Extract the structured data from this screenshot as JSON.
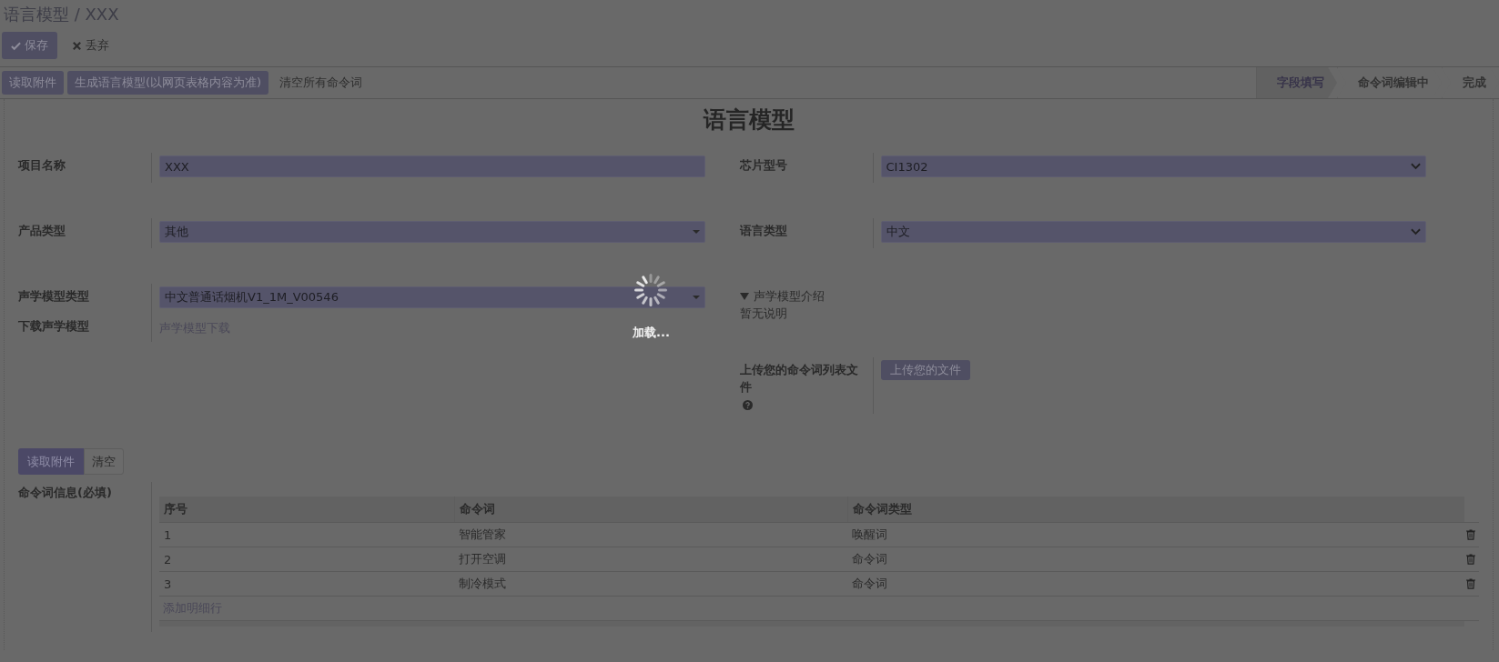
{
  "breadcrumb": "语言模型 / XXX",
  "actions": [
    {
      "kind": "primary",
      "label": "保存"
    },
    {
      "kind": "link",
      "label": "丢弃"
    }
  ],
  "toolbar": [
    {
      "kind": "button",
      "label": "读取附件"
    },
    {
      "kind": "button",
      "label": "生成语言模型(以网页表格内容为准)"
    },
    {
      "kind": "link",
      "label": "清空所有命令词"
    }
  ],
  "status_bar": [
    {
      "label": "字段填写",
      "selected": true
    },
    {
      "label": "命令词编辑中",
      "selected": false
    },
    {
      "label": "完成",
      "selected": false
    }
  ],
  "form_title": "语言模型",
  "left_groups": [
    [
      {
        "kind": "input",
        "label": "项目名称",
        "value": "XXX"
      }
    ],
    [
      {
        "kind": "select",
        "label": "产品类型",
        "value": "其他"
      }
    ],
    [
      {
        "kind": "select",
        "label": "声学模型类型",
        "value": "中文普通话烟机V1_1M_V00546"
      },
      {
        "kind": "link",
        "label": "下载声学模型",
        "value": "声学模型下载"
      }
    ]
  ],
  "right_groups": [
    [
      {
        "kind": "native",
        "label": "芯片型号",
        "value": "CI1302"
      }
    ],
    [
      {
        "kind": "native",
        "label": "语言类型",
        "value": "中文"
      }
    ],
    [
      {
        "kind": "details",
        "summary": "声学模型介绍",
        "expanded": true,
        "value": "暂无说明"
      }
    ],
    [
      {
        "kind": "upload",
        "label": "上传您的命令词列表文件",
        "value": "上传您的文件"
      }
    ]
  ],
  "command_buttons": [
    {
      "kind": "primary",
      "label": "读取附件"
    },
    {
      "kind": "secondary",
      "label": "清空"
    }
  ],
  "command_label": "命令词信息(必填)",
  "table": {
    "columns": [
      "序号",
      "命令词",
      "命令词类型"
    ],
    "rows": [
      {
        "cells": [
          "1",
          "智能管家",
          "唤醒词"
        ]
      },
      {
        "cells": [
          "2",
          "打开空调",
          "命令词"
        ]
      },
      {
        "cells": [
          "3",
          "制冷模式",
          "命令词"
        ]
      }
    ],
    "add_line": "添加明细行"
  },
  "loading": "加载..."
}
